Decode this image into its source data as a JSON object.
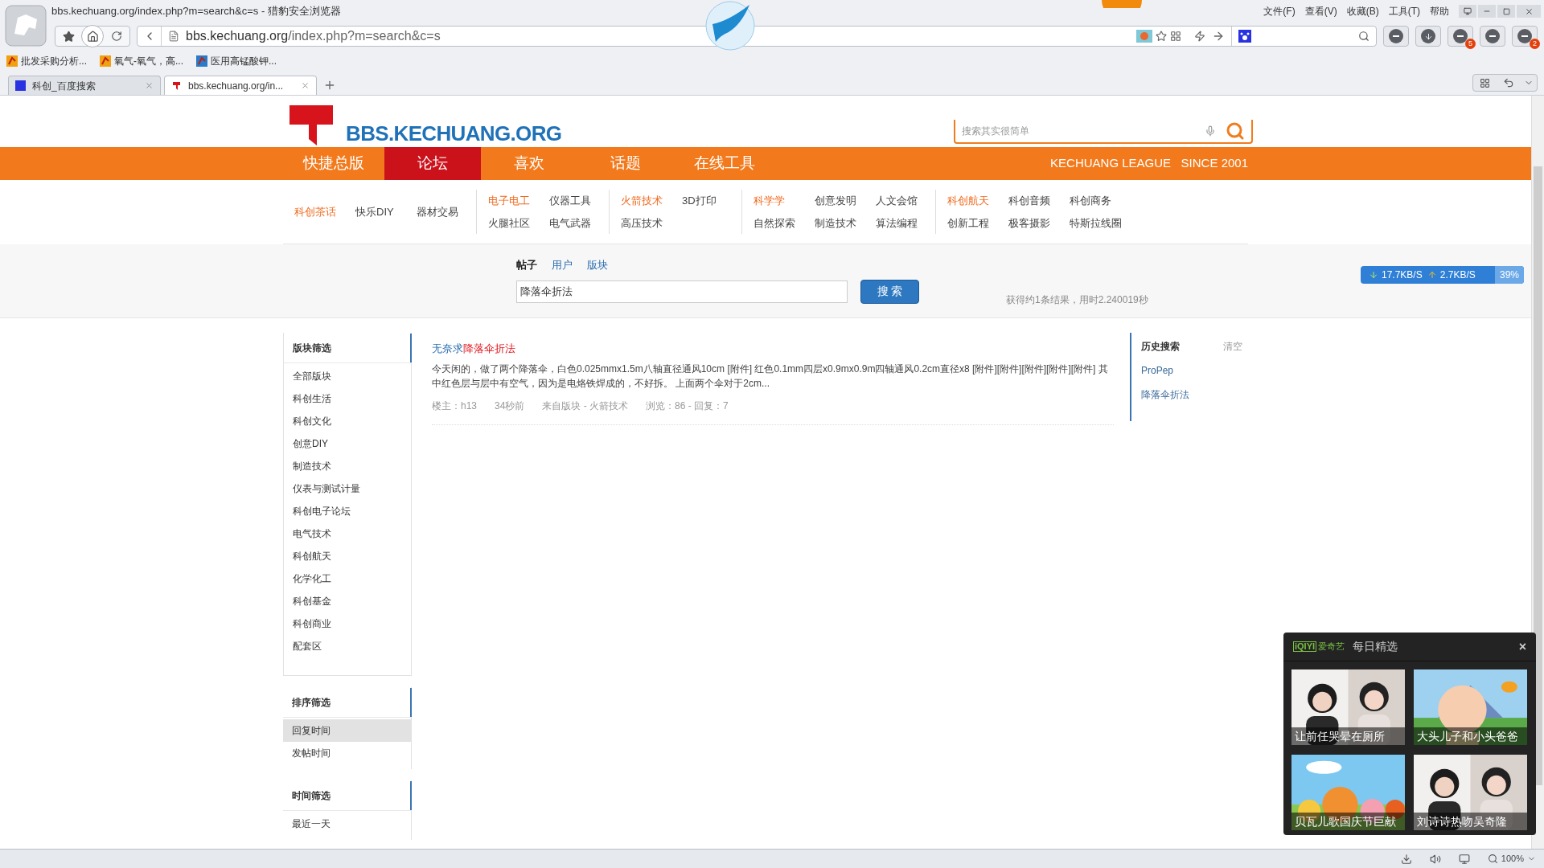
{
  "browser": {
    "title": "bbs.kechuang.org/index.php?m=search&c=s - 猎豹安全浏览器",
    "menu": [
      "文件(F)",
      "查看(V)",
      "收藏(B)",
      "工具(T)",
      "帮助"
    ],
    "address": {
      "host": "bbs.kechuang.org",
      "path": "/index.php?m=search&c=s"
    },
    "bookmarks": [
      "批发采购分析...",
      "氧气-氧气，高...",
      "医用高锰酸钾..."
    ],
    "tabs": [
      {
        "label": "科创_百度搜索",
        "selected": false
      },
      {
        "label": "bbs.kechuang.org/in...",
        "selected": true
      }
    ],
    "toolbar_badges": [
      "5",
      "2"
    ],
    "zoom": "100%"
  },
  "header": {
    "logo_text": "BBS.KECHUANG.ORG",
    "search_placeholder": "搜索其实很简单"
  },
  "nav": {
    "items": [
      {
        "label": "快捷总版",
        "selected": false
      },
      {
        "label": "论坛",
        "selected": true
      },
      {
        "label": "喜欢",
        "selected": false
      },
      {
        "label": "话题",
        "selected": false
      },
      {
        "label": "在线工具",
        "selected": false
      }
    ],
    "slogan": "KECHUANG LEAGUE   SINCE 2001"
  },
  "subnav": [
    {
      "rows": [
        [
          {
            "label": "科创茶话",
            "featured": true
          },
          {
            "label": "快乐DIY",
            "featured": false
          },
          {
            "label": "器材交易",
            "featured": false
          }
        ]
      ]
    },
    {
      "rows": [
        [
          {
            "label": "电子电工",
            "featured": true
          },
          {
            "label": "仪器工具",
            "featured": false
          }
        ],
        [
          {
            "label": "火腿社区",
            "featured": false
          },
          {
            "label": "电气武器",
            "featured": false
          }
        ]
      ]
    },
    {
      "rows": [
        [
          {
            "label": "火箭技术",
            "featured": true
          },
          {
            "label": "3D打印",
            "featured": false
          }
        ],
        [
          {
            "label": "高压技术",
            "featured": false
          }
        ]
      ]
    },
    {
      "rows": [
        [
          {
            "label": "科学学",
            "featured": true
          },
          {
            "label": "创意发明",
            "featured": false
          },
          {
            "label": "人文会馆",
            "featured": false
          }
        ],
        [
          {
            "label": "自然探索",
            "featured": false
          },
          {
            "label": "制造技术",
            "featured": false
          },
          {
            "label": "算法编程",
            "featured": false
          }
        ]
      ]
    },
    {
      "rows": [
        [
          {
            "label": "科创航天",
            "featured": true
          },
          {
            "label": "科创音频",
            "featured": false
          },
          {
            "label": "科创商务",
            "featured": false
          }
        ],
        [
          {
            "label": "创新工程",
            "featured": false
          },
          {
            "label": "极客摄影",
            "featured": false
          },
          {
            "label": "特斯拉线圈",
            "featured": false
          }
        ]
      ]
    }
  ],
  "search": {
    "tabs": [
      {
        "label": "帖子",
        "selected": true
      },
      {
        "label": "用户",
        "selected": false
      },
      {
        "label": "版块",
        "selected": false
      }
    ],
    "value": "降落伞折法",
    "button": "搜 索",
    "result_info": "获得约1条结果，用时2.240019秒"
  },
  "sidebar": [
    {
      "title": "版块筛选",
      "items": [
        {
          "label": "全部版块",
          "selected": false
        },
        {
          "label": "科创生活",
          "selected": false
        },
        {
          "label": "科创文化",
          "selected": false
        },
        {
          "label": "创意DIY",
          "selected": false
        },
        {
          "label": "制造技术",
          "selected": false
        },
        {
          "label": "仪表与测试计量",
          "selected": false
        },
        {
          "label": "科创电子论坛",
          "selected": false
        },
        {
          "label": "电气技术",
          "selected": false
        },
        {
          "label": "科创航天",
          "selected": false
        },
        {
          "label": "化学化工",
          "selected": false
        },
        {
          "label": "科创基金",
          "selected": false
        },
        {
          "label": "科创商业",
          "selected": false
        },
        {
          "label": "配套区",
          "selected": false
        }
      ]
    },
    {
      "title": "排序筛选",
      "items": [
        {
          "label": "回复时间",
          "selected": true
        },
        {
          "label": "发帖时间",
          "selected": false
        }
      ]
    },
    {
      "title": "时间筛选",
      "items": [
        {
          "label": "最近一天",
          "selected": false
        }
      ]
    }
  ],
  "results": [
    {
      "title_prefix": "无奈求",
      "title_match": "降落伞折法",
      "excerpt": "今天闲的，做了两个降落伞，白色0.025mmx1.5m八轴直径通风10cm [附件] 红色0.1mm四层x0.9mx0.9m四轴通风0.2cm直径x8 [附件][附件][附件][附件][附件] 其中红色层与层中有空气，因为是电烙铁焊成的，不好拆。 上面两个伞对于2cm...",
      "author": "楼主：h13",
      "time": "34秒前",
      "board": "来自版块 - 火箭技术",
      "stats": "浏览：86 - 回复：7"
    }
  ],
  "history": {
    "title": "历史搜索",
    "clear": "清空",
    "items": [
      "ProPep",
      "降落伞折法"
    ]
  },
  "speed": {
    "down": "17.7KB/S",
    "up": "2.7KB/S",
    "percent": "39%"
  },
  "popup": {
    "brand_logo": "iQIYI",
    "brand": "爱奇艺",
    "title": "每日精选",
    "close": "×",
    "videos": [
      {
        "caption": "让前任哭晕在厕所",
        "kind": "picture"
      },
      {
        "caption": "大头儿子和小头爸爸",
        "kind": "picture"
      },
      {
        "caption": "贝瓦儿歌国庆节巨献",
        "kind": "picture"
      },
      {
        "caption": "刘诗诗热吻吴奇隆",
        "kind": "picture"
      }
    ]
  }
}
